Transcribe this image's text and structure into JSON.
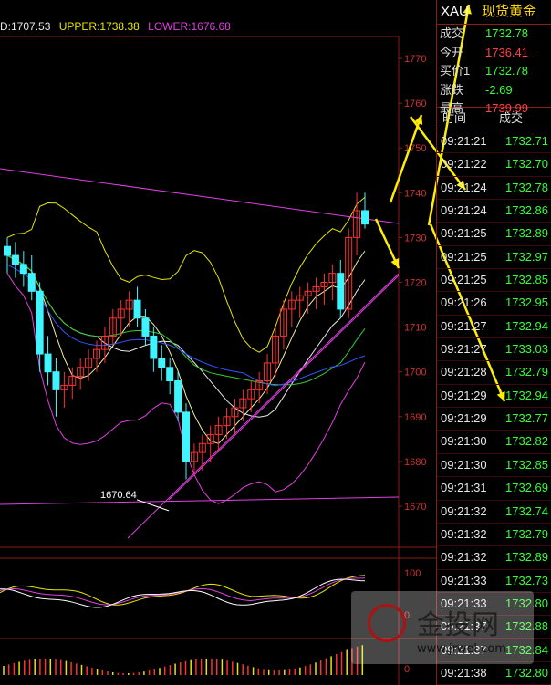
{
  "legend": {
    "mid": "D:1707.53",
    "upper": "UPPER:1738.38",
    "lower": "LOWER:1676.68"
  },
  "annotation": {
    "low_label": "1670.64"
  },
  "instrument": {
    "symbol": "XAU",
    "name": "现货黄金"
  },
  "quotes": [
    {
      "label": "成交",
      "value": "1732.78",
      "color": "#33ff33"
    },
    {
      "label": "今开",
      "value": "1736.41",
      "color": "#ff4040"
    },
    {
      "label": "买价1",
      "value": "1732.78",
      "color": "#33ff33"
    },
    {
      "label": "涨跌",
      "value": "-2.69",
      "color": "#33ff33"
    },
    {
      "label": "最高",
      "value": "1739.99",
      "color": "#ff4040"
    }
  ],
  "ticks_header": {
    "time": "时间",
    "price": "成交"
  },
  "ticks": [
    {
      "time": "09:21:21",
      "price": "1732.71"
    },
    {
      "time": "09:21:22",
      "price": "1732.70"
    },
    {
      "time": "09:21:24",
      "price": "1732.78"
    },
    {
      "time": "09:21:24",
      "price": "1732.86"
    },
    {
      "time": "09:21:25",
      "price": "1732.89"
    },
    {
      "time": "09:21:25",
      "price": "1732.97"
    },
    {
      "time": "09:21:25",
      "price": "1732.85"
    },
    {
      "time": "09:21:26",
      "price": "1732.95"
    },
    {
      "time": "09:21:27",
      "price": "1732.94"
    },
    {
      "time": "09:21:27",
      "price": "1733.03"
    },
    {
      "time": "09:21:28",
      "price": "1732.79"
    },
    {
      "time": "09:21:29",
      "price": "1732.94"
    },
    {
      "time": "09:21:29",
      "price": "1732.77"
    },
    {
      "time": "09:21:30",
      "price": "1732.82"
    },
    {
      "time": "09:21:30",
      "price": "1732.85"
    },
    {
      "time": "09:21:31",
      "price": "1732.69"
    },
    {
      "time": "09:21:32",
      "price": "1732.74"
    },
    {
      "time": "09:21:32",
      "price": "1732.79"
    },
    {
      "time": "09:21:32",
      "price": "1732.89"
    },
    {
      "time": "09:21:33",
      "price": "1732.73"
    },
    {
      "time": "09:21:33",
      "price": "1732.80"
    },
    {
      "time": "09:21:37",
      "price": "1732.88"
    },
    {
      "time": "09:21:37",
      "price": "1732.84"
    },
    {
      "time": "09:21:38",
      "price": "1732.80"
    }
  ],
  "watermark": {
    "name": "金投网",
    "url": "www.jrwel.com"
  },
  "chart_data": {
    "type": "candlestick",
    "price_axis": {
      "ticks": [
        1670,
        1680,
        1690,
        1700,
        1710,
        1720,
        1730,
        1740,
        1750,
        1760,
        1770
      ],
      "range": [
        1667,
        1775
      ]
    },
    "candles": [
      [
        1728,
        1730,
        1722,
        1726
      ],
      [
        1726,
        1729,
        1721,
        1724
      ],
      [
        1724,
        1727,
        1719,
        1722
      ],
      [
        1722,
        1726,
        1716,
        1718
      ],
      [
        1718,
        1720,
        1700,
        1704
      ],
      [
        1704,
        1708,
        1697,
        1700
      ],
      [
        1700,
        1703,
        1690,
        1696
      ],
      [
        1696,
        1700,
        1692,
        1697
      ],
      [
        1697,
        1701,
        1694,
        1699
      ],
      [
        1699,
        1703,
        1696,
        1701
      ],
      [
        1701,
        1705,
        1698,
        1703
      ],
      [
        1703,
        1707,
        1700,
        1705
      ],
      [
        1705,
        1710,
        1702,
        1708
      ],
      [
        1708,
        1714,
        1706,
        1712
      ],
      [
        1712,
        1716,
        1708,
        1714
      ],
      [
        1714,
        1718,
        1710,
        1716
      ],
      [
        1716,
        1719,
        1710,
        1712
      ],
      [
        1712,
        1714,
        1706,
        1708
      ],
      [
        1708,
        1710,
        1700,
        1703
      ],
      [
        1703,
        1706,
        1698,
        1701
      ],
      [
        1701,
        1703,
        1695,
        1698
      ],
      [
        1698,
        1700,
        1689,
        1691
      ],
      [
        1691,
        1693,
        1676,
        1680
      ],
      [
        1680,
        1684,
        1677,
        1682
      ],
      [
        1682,
        1686,
        1678,
        1684
      ],
      [
        1684,
        1688,
        1680,
        1686
      ],
      [
        1686,
        1690,
        1682,
        1688
      ],
      [
        1688,
        1692,
        1685,
        1690
      ],
      [
        1690,
        1694,
        1686,
        1692
      ],
      [
        1692,
        1696,
        1689,
        1694
      ],
      [
        1694,
        1698,
        1691,
        1696
      ],
      [
        1696,
        1700,
        1693,
        1698
      ],
      [
        1698,
        1704,
        1695,
        1702
      ],
      [
        1702,
        1710,
        1699,
        1708
      ],
      [
        1708,
        1716,
        1705,
        1714
      ],
      [
        1714,
        1718,
        1710,
        1716
      ],
      [
        1716,
        1719,
        1712,
        1717
      ],
      [
        1717,
        1720,
        1713,
        1718
      ],
      [
        1718,
        1721,
        1714,
        1719
      ],
      [
        1719,
        1722,
        1715,
        1720
      ],
      [
        1720,
        1724,
        1716,
        1722
      ],
      [
        1722,
        1725,
        1712,
        1714
      ],
      [
        1714,
        1732,
        1712,
        1730
      ],
      [
        1730,
        1740,
        1726,
        1736
      ],
      [
        1736,
        1740,
        1732,
        1733
      ]
    ],
    "annotations": [
      {
        "label": "1670.64",
        "value": 1670.64
      }
    ]
  },
  "colors": {
    "up": "#ff3030",
    "down": "#3ff3ff",
    "axis": "#8b1a1a",
    "upper_band": "#e6e600",
    "lower_band": "#e040e0",
    "mid_band": "#e8e8e8",
    "ma_green": "#33cc33",
    "ma_blue": "#3355ff",
    "arrow": "#ffee00"
  }
}
